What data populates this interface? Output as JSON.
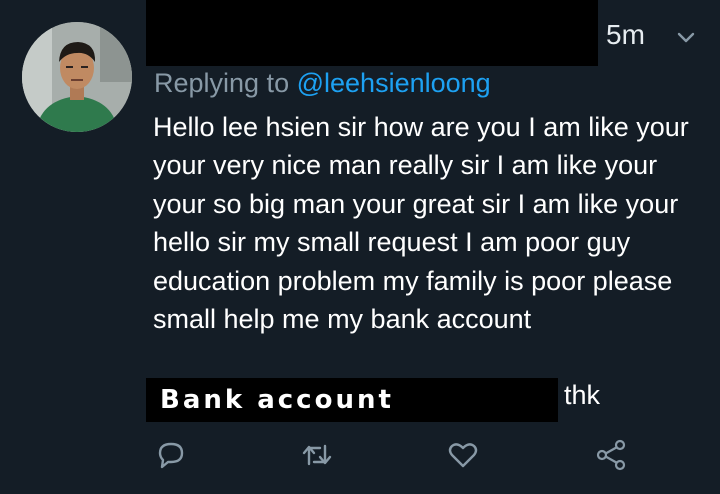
{
  "tweet": {
    "timestamp": "5m",
    "reply_prefix": "Replying to",
    "reply_handle": "@leehsienloong",
    "body": "Hello lee hsien sir how are you I am like your your very nice man really sir I am like your your so big man your great sir I am like your hello sir my small request I am poor guy education problem my family is poor please small help me my bank account",
    "redacted_label": "Bank account",
    "trailing_text": "thk"
  },
  "icons": {
    "more": "chevron-down-icon",
    "reply": "reply-icon",
    "retweet": "retweet-icon",
    "like": "heart-icon",
    "share": "share-icon"
  },
  "colors": {
    "background": "#141d26",
    "muted": "#8899a6",
    "link": "#1da1f2",
    "text": "#ffffff",
    "redaction": "#000000"
  }
}
